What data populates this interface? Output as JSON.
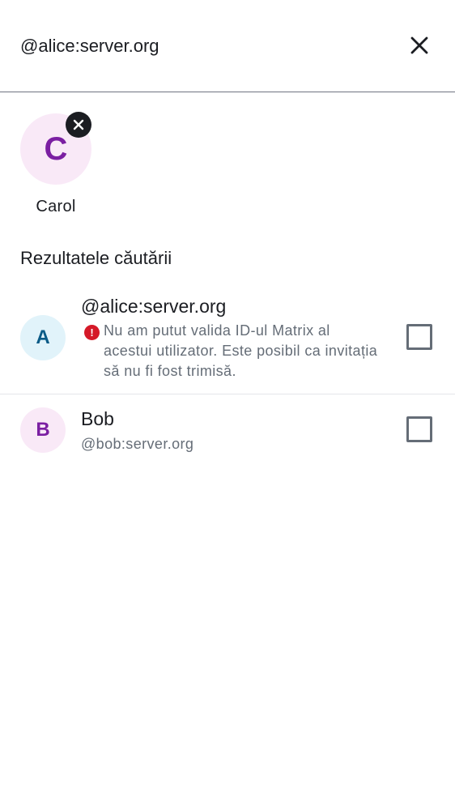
{
  "search": {
    "value": "@alice:server.org",
    "close_icon": "close-icon"
  },
  "selected": [
    {
      "initial": "C",
      "name": "Carol",
      "avatar_color": "#7b1fa2",
      "avatar_bg": "#f9e9f7",
      "remove_icon": "close-icon"
    }
  ],
  "results": {
    "header": "Rezultatele căutării",
    "items": [
      {
        "initial": "A",
        "title": "@alice:server.org",
        "error_icon": "error-icon",
        "error_text": "Nu am putut valida ID-ul Matrix al acestui utilizator. Este posibil ca invitația să nu fi fost trimisă.",
        "checked": false,
        "avatar_color": "#0a5b87",
        "avatar_bg": "#e1f3fa"
      },
      {
        "initial": "B",
        "title": "Bob",
        "subtitle": "@bob:server.org",
        "checked": false,
        "avatar_color": "#7b1fa2",
        "avatar_bg": "#f9e9f7"
      }
    ]
  },
  "colors": {
    "error": "#d51928",
    "divider": "#6f7480",
    "secondary_text": "#656d77"
  }
}
